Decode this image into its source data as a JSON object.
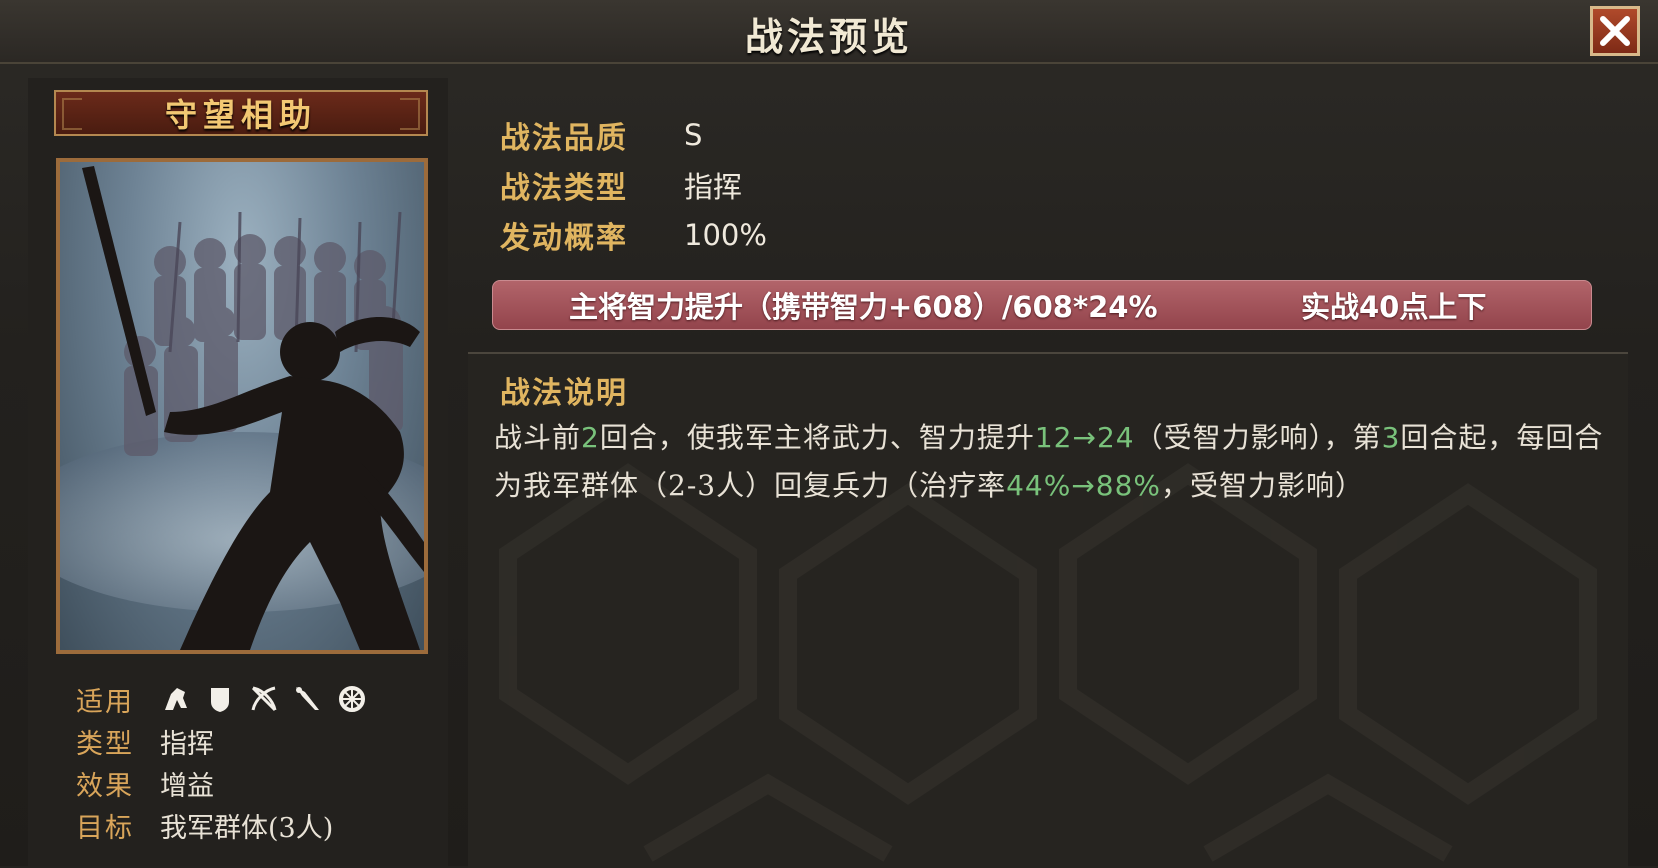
{
  "header": {
    "title": "战法预览"
  },
  "close_icon": "close-icon",
  "skill": {
    "name": "守望相助",
    "attributes": [
      {
        "key": "适用",
        "icons": [
          "cavalry-icon",
          "shield-icon",
          "crossed-bows-icon",
          "spear-icon",
          "wheel-icon"
        ]
      },
      {
        "key": "类型",
        "value": "指挥"
      },
      {
        "key": "效果",
        "value": "增益"
      },
      {
        "key": "目标",
        "value": "我军群体(3人)"
      }
    ]
  },
  "info": {
    "quality_label": "战法品质",
    "quality_value": "S",
    "type_label": "战法类型",
    "type_value": "指挥",
    "rate_label": "发动概率",
    "rate_value": "100%"
  },
  "highlight": {
    "left": "主将智力提升（携带智力+608）/608*24%",
    "right": "实战40点上下"
  },
  "description": {
    "title": "战法说明",
    "segments": [
      {
        "text": "战斗前",
        "hl": false
      },
      {
        "text": "2",
        "hl": true
      },
      {
        "text": "回合，使我军主将武力、智力提升",
        "hl": false
      },
      {
        "text": "12→24",
        "hl": true
      },
      {
        "text": "（受智力影响），第",
        "hl": false
      },
      {
        "text": "3",
        "hl": true
      },
      {
        "text": "回合起，每回合为我军群体（2-3人）回复兵力（治疗率",
        "hl": false
      },
      {
        "text": "44%→88%",
        "hl": true
      },
      {
        "text": "，受智力影响）",
        "hl": false
      }
    ]
  },
  "colors": {
    "accent": "#e0b560",
    "highlight_bar": "#a9565d",
    "number_green": "#79c27b"
  }
}
